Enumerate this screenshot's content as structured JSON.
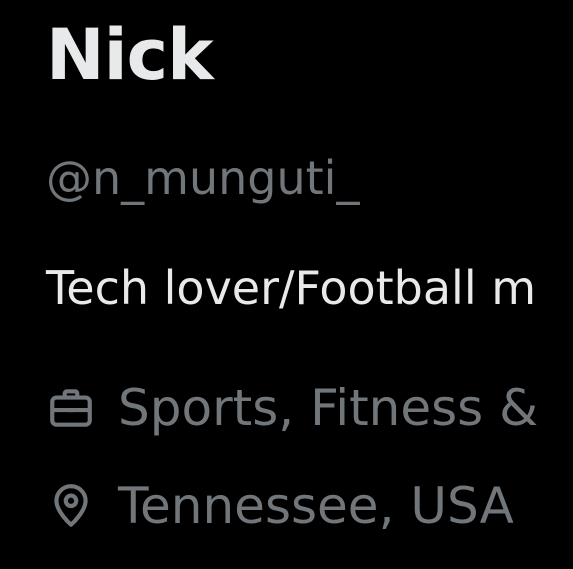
{
  "profile": {
    "display_name": "Nick",
    "handle": "@n_munguti_",
    "bio": "Tech lover/Football m",
    "category": {
      "icon": "briefcase-icon",
      "label": "Sports, Fitness &"
    },
    "location": {
      "icon": "location-pin-icon",
      "label": "Tennessee, USA"
    }
  },
  "colors": {
    "background": "#000000",
    "primary_text": "#e7e9ea",
    "secondary_text": "#71767b"
  }
}
